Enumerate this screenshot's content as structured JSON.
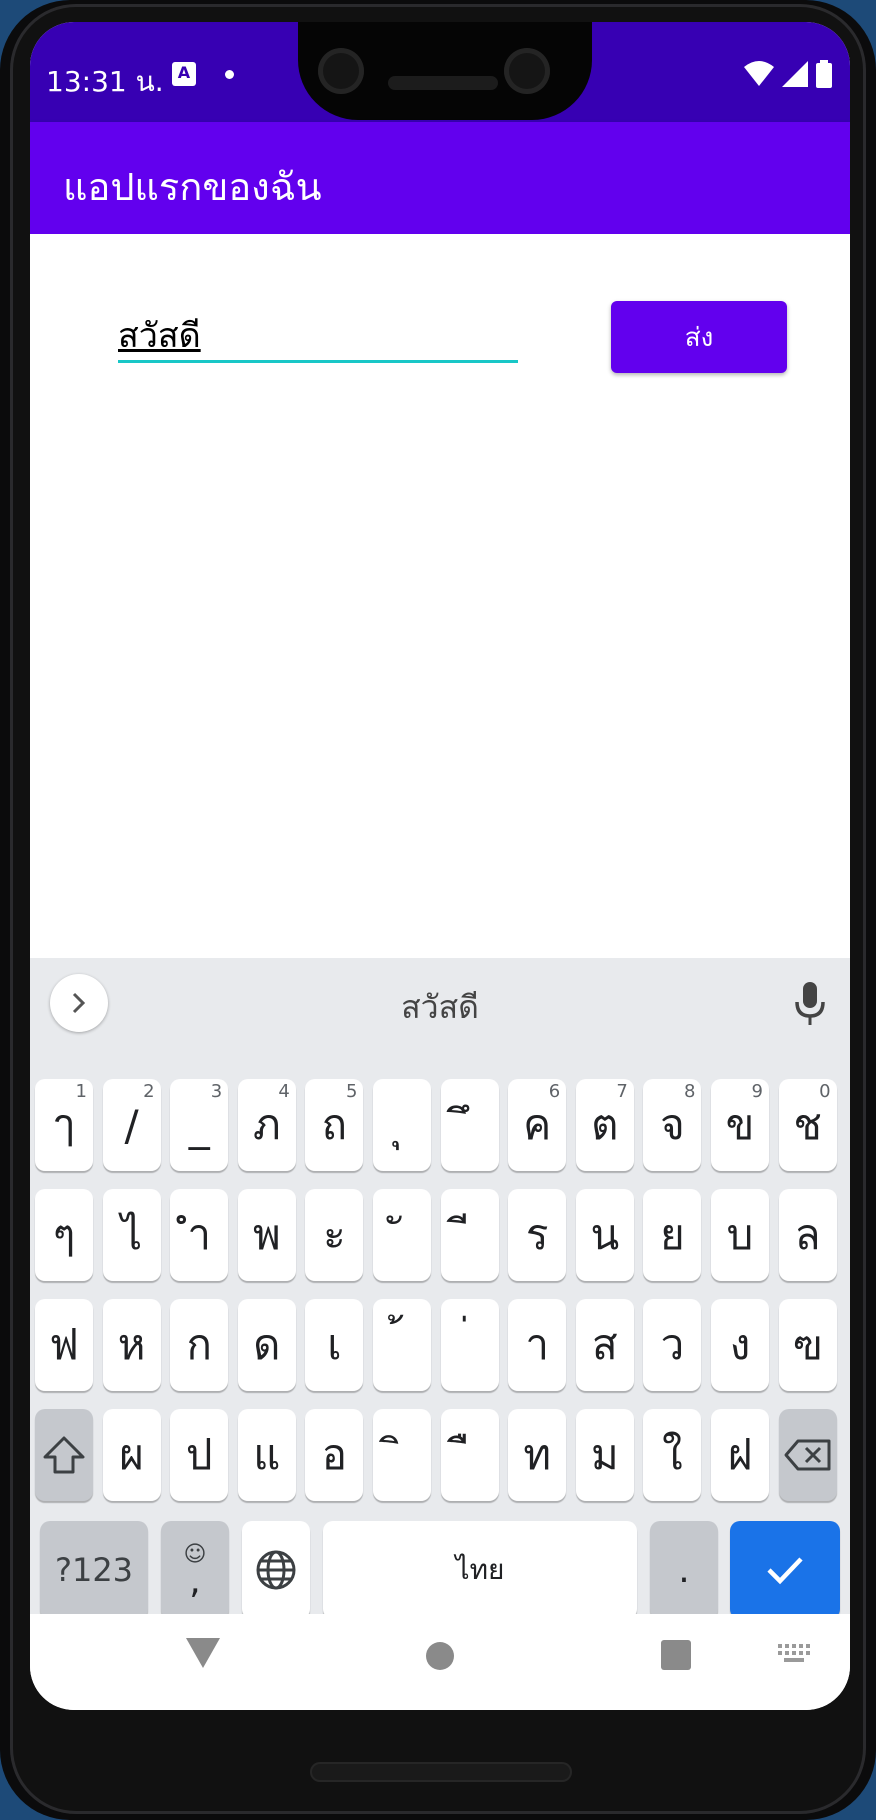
{
  "status_bar": {
    "time": "13:31 น.",
    "notif_icon": "A"
  },
  "app_bar": {
    "title": "แอปแรกของฉัน"
  },
  "main": {
    "input_value": "สวัสดี",
    "send_label": "ส่ง"
  },
  "keyboard": {
    "suggestion": "สวัสดี",
    "row1": [
      {
        "k": "ๅ",
        "h": "1"
      },
      {
        "k": "/",
        "h": "2"
      },
      {
        "k": "_",
        "h": "3"
      },
      {
        "k": "ภ",
        "h": "4"
      },
      {
        "k": "ถ",
        "h": "5"
      },
      {
        "k": "ุ",
        "h": ""
      },
      {
        "k": "ึ",
        "h": ""
      },
      {
        "k": "ค",
        "h": "6"
      },
      {
        "k": "ต",
        "h": "7"
      },
      {
        "k": "จ",
        "h": "8"
      },
      {
        "k": "ข",
        "h": "9"
      },
      {
        "k": "ช",
        "h": "0"
      }
    ],
    "row2": [
      "ๆ",
      "ไ",
      "ำ",
      "พ",
      "ะ",
      "ั",
      "ี",
      "ร",
      "น",
      "ย",
      "บ",
      "ล"
    ],
    "row3": [
      "ฟ",
      "ห",
      "ก",
      "ด",
      "เ",
      "้",
      "่",
      "า",
      "ส",
      "ว",
      "ง",
      "ฃ"
    ],
    "row4": [
      "ผ",
      "ป",
      "แ",
      "อ",
      "ิ",
      "ื",
      "ท",
      "ม",
      "ใ",
      "ฝ"
    ],
    "symbols_label": "?123",
    "emoji_comma_label": ",",
    "space_label": "ไทย",
    "period_label": "."
  },
  "colors": {
    "primary": "#6200ee",
    "primary_dark": "#3700b3",
    "accent_underline": "#18c7c7",
    "enter_key": "#1a73e8"
  }
}
